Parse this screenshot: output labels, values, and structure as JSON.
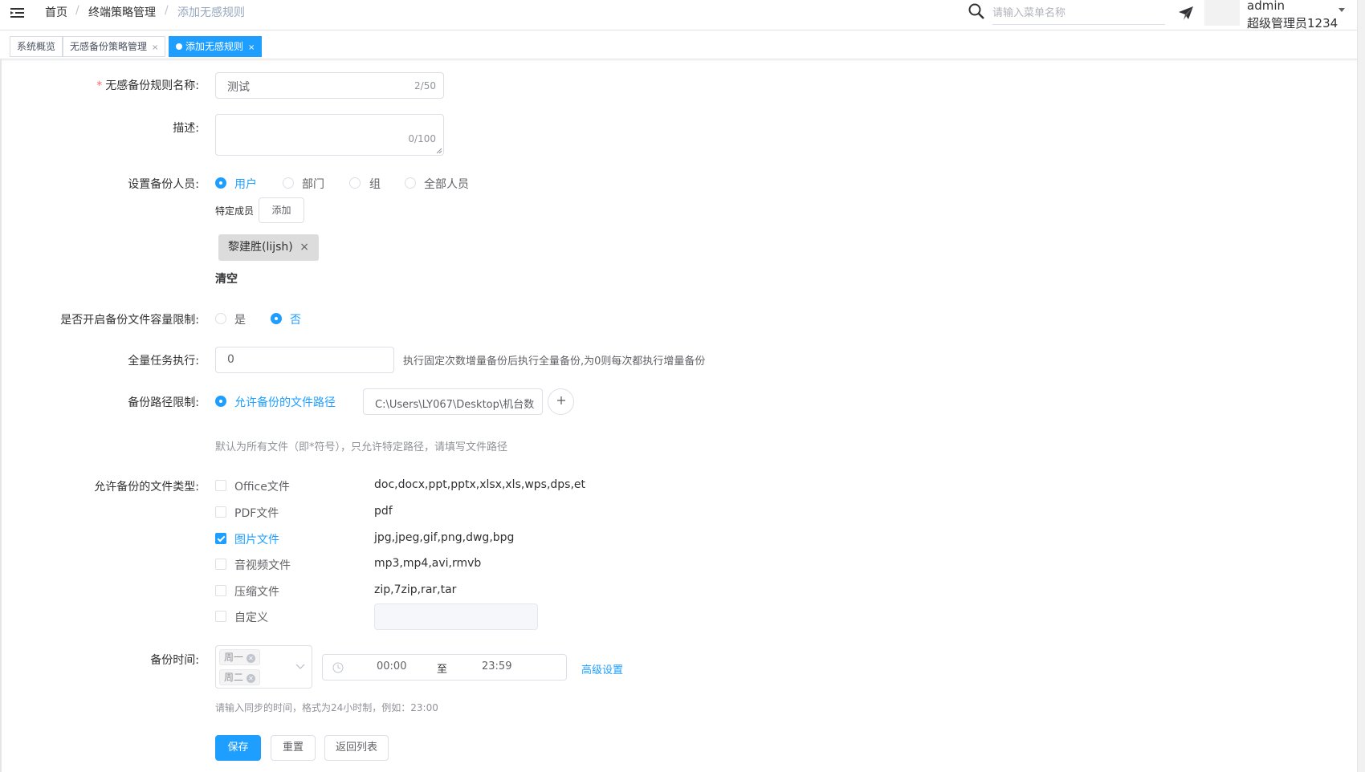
{
  "header": {
    "breadcrumb": [
      "首页",
      "终端策略管理",
      "添加无感规则"
    ],
    "breadcrumb_sep": "/",
    "search_placeholder": "请输入菜单名称",
    "user_name": "admin",
    "user_role": "超级管理员1234"
  },
  "tabs": [
    {
      "label": "系统概览",
      "closable": false,
      "active": false
    },
    {
      "label": "无感备份策略管理",
      "closable": true,
      "active": false
    },
    {
      "label": "添加无感规则",
      "closable": true,
      "active": true
    }
  ],
  "tab_close": "×",
  "form": {
    "rule_name": {
      "label": "无感备份规则名称:",
      "required_mark": "*",
      "value": "测试",
      "counter": "2/50"
    },
    "description": {
      "label": "描述:",
      "value": "",
      "counter": "0/100"
    },
    "backup_users": {
      "label": "设置备份人员:",
      "options": [
        "用户",
        "部门",
        "组",
        "全部人员"
      ],
      "selected": "用户",
      "specific_members_label": "特定成员",
      "add_button": "添加",
      "member_tag": "黎建胜(lijsh)",
      "tag_close": "×",
      "clear_link": "清空"
    },
    "capacity_limit": {
      "label": "是否开启备份文件容量限制:",
      "options": [
        "是",
        "否"
      ],
      "selected": "否"
    },
    "full_task": {
      "label": "全量任务执行:",
      "value": "0",
      "hint": "执行固定次数增量备份后执行全量备份,为0则每次都执行增量备份"
    },
    "path_limit": {
      "label": "备份路径限制:",
      "option": "允许备份的文件路径",
      "path_value": "C:\\Users\\LY067\\Desktop\\机台数",
      "add_icon": "plus-icon",
      "hint": "默认为所有文件（即*符号），只允许特定路径，请填写文件路径"
    },
    "file_types": {
      "label": "允许备份的文件类型:",
      "items": [
        {
          "name": "Office文件",
          "ext": "doc,docx,ppt,pptx,xlsx,xls,wps,dps,et",
          "checked": false
        },
        {
          "name": "PDF文件",
          "ext": "pdf",
          "checked": false
        },
        {
          "name": "图片文件",
          "ext": "jpg,jpeg,gif,png,dwg,bpg",
          "checked": true
        },
        {
          "name": "音视频文件",
          "ext": "mp3,mp4,avi,rmvb",
          "checked": false
        },
        {
          "name": "压缩文件",
          "ext": "zip,7zip,rar,tar",
          "checked": false
        },
        {
          "name": "自定义",
          "ext": "",
          "checked": false
        }
      ]
    },
    "backup_time": {
      "label": "备份时间:",
      "days": [
        "周一",
        "周二"
      ],
      "start": "00:00",
      "to": "至",
      "end": "23:59",
      "advanced": "高级设置",
      "hint": "请输入同步的时间，格式为24小时制，例如：23:00"
    },
    "buttons": {
      "save": "保存",
      "reset": "重置",
      "back": "返回列表"
    }
  },
  "colors": {
    "primary": "#1e9fff",
    "required": "#f56c6c"
  }
}
